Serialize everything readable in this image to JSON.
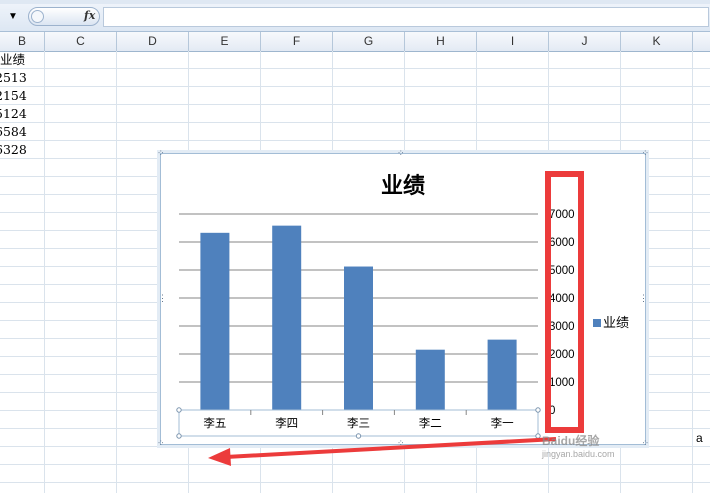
{
  "columns": [
    "B",
    "C",
    "D",
    "E",
    "F",
    "G",
    "H",
    "I",
    "J",
    "K"
  ],
  "cells": [
    "业绩",
    "2513",
    "2154",
    "5124",
    "6584",
    "6328"
  ],
  "formula_bar": {
    "fx_label": "fx",
    "namebox_arrow": "▼"
  },
  "chart_data": {
    "type": "bar",
    "title": "业绩",
    "categories": [
      "李五",
      "李四",
      "李三",
      "李二",
      "李一"
    ],
    "series": [
      {
        "name": "业绩",
        "values": [
          6328,
          6584,
          5124,
          2154,
          2513
        ],
        "color": "#4f81bd"
      }
    ],
    "ylim": [
      0,
      7000
    ],
    "yticks": [
      "0",
      "1000",
      "2000",
      "3000",
      "4000",
      "5000",
      "6000",
      "7000"
    ],
    "y_axis_side": "right",
    "grid": true,
    "legend": "right"
  },
  "annotation": {
    "highlight_color": "#ec3b3b",
    "arrow_color": "#ec3b3b"
  },
  "watermark": {
    "text": "Baidu经验",
    "url": "jingyan.baidu.com"
  },
  "stray_text": "a"
}
